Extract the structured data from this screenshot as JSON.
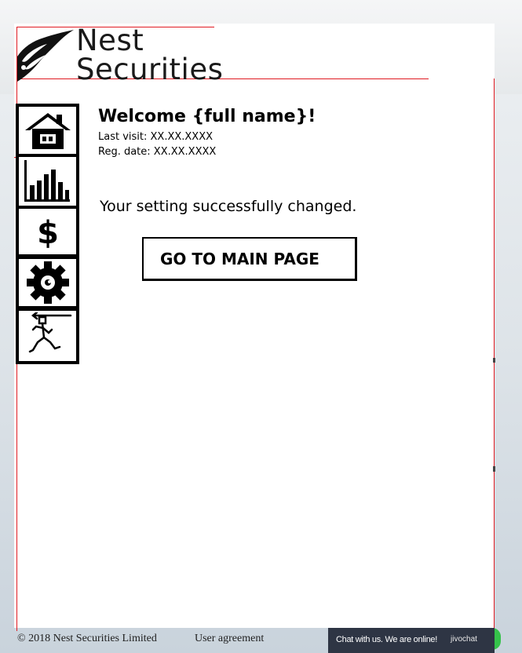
{
  "brand": {
    "line1": "Nest",
    "line2": "Securities"
  },
  "nav": [
    {
      "name": "home",
      "icon": "house-icon"
    },
    {
      "name": "statistics",
      "icon": "bar-chart-icon"
    },
    {
      "name": "finance",
      "icon": "dollar-icon"
    },
    {
      "name": "settings",
      "icon": "gear-icon"
    },
    {
      "name": "logout",
      "icon": "running-exit-icon"
    }
  ],
  "welcome": {
    "title": "Welcome {full name}!",
    "last_visit": "Last visit: XX.XX.XXXX",
    "reg_date": "Reg. date: XX.XX.XXXX"
  },
  "message": "Your setting successfully changed.",
  "main_button_label": "GO TO MAIN PAGE",
  "footer": {
    "copyright": "© 2018 Nest Securities Limited",
    "agreement": "User agreement"
  },
  "chat": {
    "text": "Chat with us. We are online!",
    "brand": "jivochat"
  },
  "colors": {
    "accent_line": "#e01a22",
    "chat_bg": "#2e3544",
    "chat_status": "#35c24a"
  }
}
